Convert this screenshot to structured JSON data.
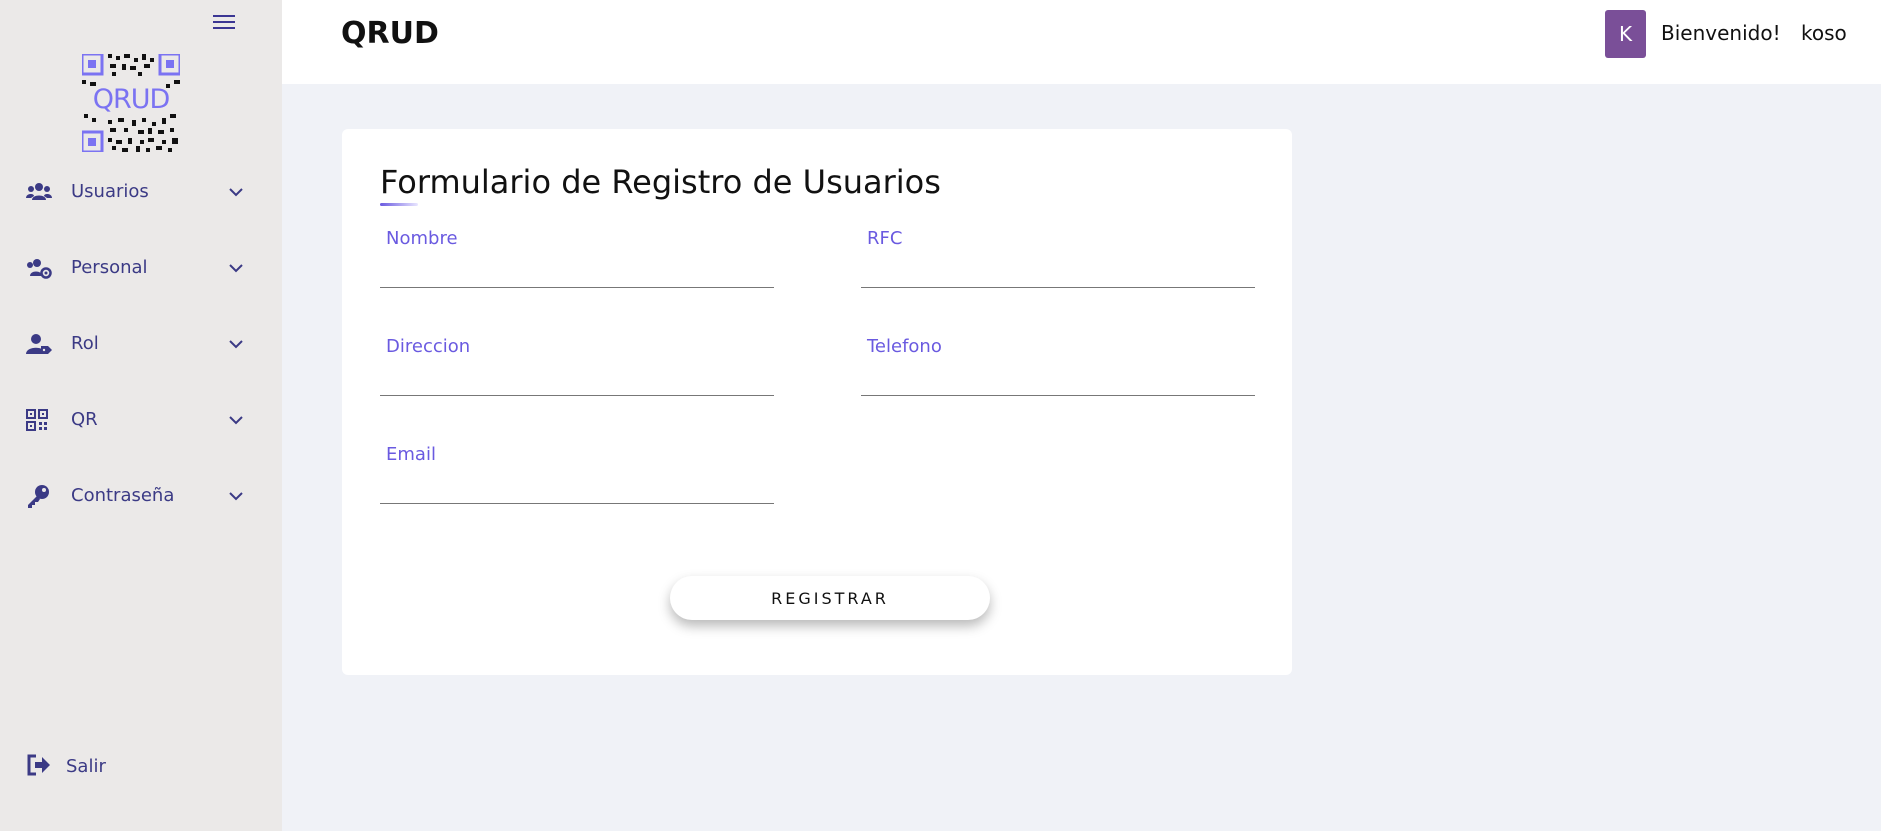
{
  "app": {
    "brand": "QRUD",
    "logo_text": "QRUD"
  },
  "sidebar": {
    "items": [
      {
        "label": "Usuarios",
        "icon": "users-icon"
      },
      {
        "label": "Personal",
        "icon": "users-gear-icon"
      },
      {
        "label": "Rol",
        "icon": "user-tag-icon"
      },
      {
        "label": "QR",
        "icon": "qrcode-icon"
      },
      {
        "label": "Contraseña",
        "icon": "key-icon"
      }
    ],
    "logout_label": "Salir"
  },
  "header": {
    "avatar_letter": "K",
    "welcome": "Bienvenido!",
    "username": "koso"
  },
  "form": {
    "title": "Formulario de Registro de Usuarios",
    "fields": {
      "nombre": {
        "label": "Nombre",
        "value": ""
      },
      "rfc": {
        "label": "RFC",
        "value": ""
      },
      "direccion": {
        "label": "Direccion",
        "value": ""
      },
      "telefono": {
        "label": "Telefono",
        "value": ""
      },
      "email": {
        "label": "Email",
        "value": ""
      }
    },
    "submit_label": "REGISTRAR"
  },
  "colors": {
    "accent": "#6a5ae0",
    "nav_text": "#3b3a85",
    "avatar_bg": "#7a4f98"
  }
}
